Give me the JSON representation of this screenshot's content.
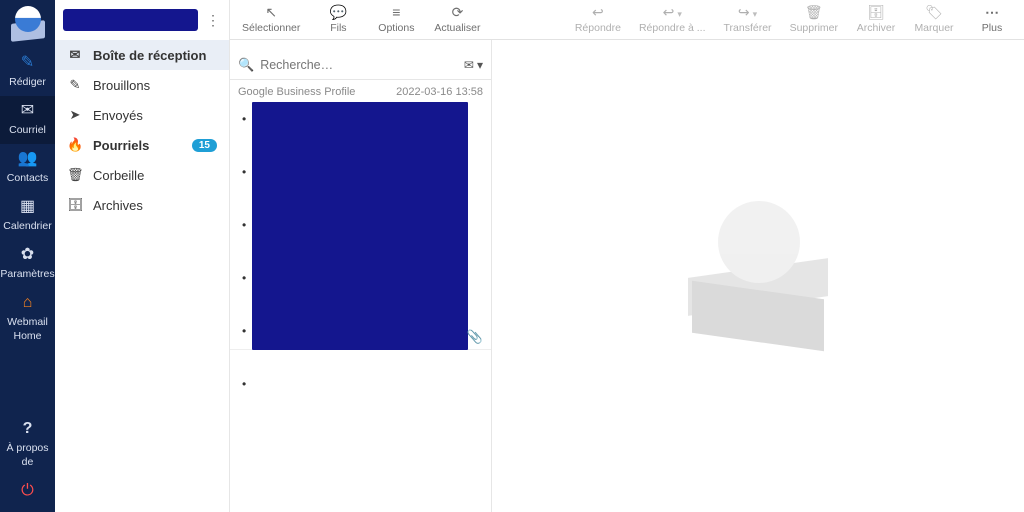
{
  "colors": {
    "navy": "#10244e",
    "redact": "#14168e",
    "badge": "#1f9fd6"
  },
  "leftnav": {
    "items": [
      {
        "label": "Rédiger",
        "icon": "✎"
      },
      {
        "label": "Courriel",
        "icon": "✉"
      },
      {
        "label": "Contacts",
        "icon": "👥"
      },
      {
        "label": "Calendrier",
        "icon": "▦"
      },
      {
        "label": "Paramètres",
        "icon": "✿"
      },
      {
        "label": "Webmail Home",
        "icon": "⌂"
      }
    ],
    "footer": [
      {
        "label": "?",
        "sublabel": "À propos de"
      },
      {
        "label": "⏻",
        "sublabel": ""
      }
    ]
  },
  "toolbar": {
    "left": [
      {
        "label": "Sélectionner",
        "icon": "↖"
      },
      {
        "label": "Fils",
        "icon": "💬"
      },
      {
        "label": "Options",
        "icon": "≡"
      },
      {
        "label": "Actualiser",
        "icon": "⟳"
      }
    ],
    "right": [
      {
        "label": "Répondre",
        "icon": "↩"
      },
      {
        "label": "Répondre à ...",
        "icon": "↩",
        "caret": true
      },
      {
        "label": "Transférer",
        "icon": "↪",
        "caret": true
      },
      {
        "label": "Supprimer",
        "icon": "🗑"
      },
      {
        "label": "Archiver",
        "icon": "🗄"
      },
      {
        "label": "Marquer",
        "icon": "🏷"
      },
      {
        "label": "Plus",
        "icon": "⋯"
      }
    ]
  },
  "folders": {
    "items": [
      {
        "label": "Boîte de réception",
        "icon": "✉",
        "active": true
      },
      {
        "label": "Brouillons",
        "icon": "✎"
      },
      {
        "label": "Envoyés",
        "icon": "➤"
      },
      {
        "label": "Pourriels",
        "icon": "🔥",
        "badge": "15",
        "bold": true
      },
      {
        "label": "Corbeille",
        "icon": "🗑"
      },
      {
        "label": "Archives",
        "icon": "🗄"
      }
    ]
  },
  "search": {
    "placeholder": "Recherche…"
  },
  "messages": [
    {
      "from": "Google Business Profile",
      "time": "2022-03-16 13:58",
      "attachment": true
    }
  ]
}
